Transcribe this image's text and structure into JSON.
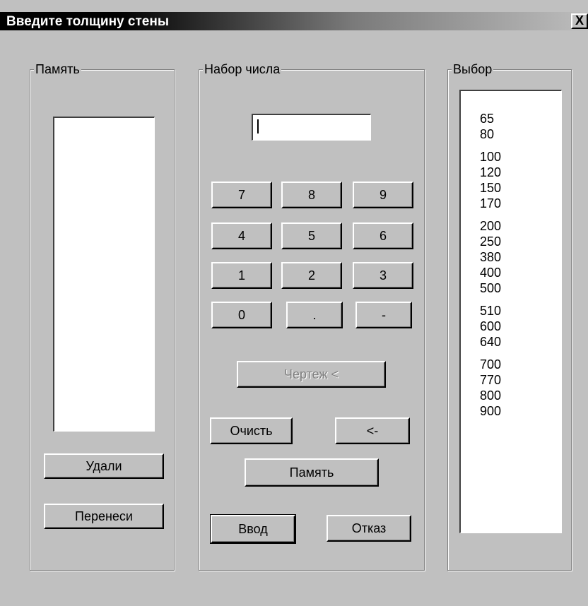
{
  "window": {
    "title": "Введите толщину стены",
    "close_label": "X"
  },
  "memory": {
    "legend": "Память",
    "delete_label": "Удали",
    "transfer_label": "Перенеси"
  },
  "entry": {
    "legend": "Набор числа",
    "input_value": "",
    "keys": [
      [
        "7",
        "8",
        "9"
      ],
      [
        "4",
        "5",
        "6"
      ],
      [
        "1",
        "2",
        "3"
      ],
      [
        "0",
        ".",
        "-"
      ]
    ],
    "drawing_label": "Чертеж <",
    "clear_label": "Очисть",
    "backspace_label": "<-",
    "memory_label": "Память",
    "enter_label": "Ввод",
    "cancel_label": "Отказ"
  },
  "choice": {
    "legend": "Выбор",
    "groups": [
      [
        "65",
        "80"
      ],
      [
        "100",
        "120",
        "150",
        "170"
      ],
      [
        "200",
        "250",
        "380",
        "400",
        "500"
      ],
      [
        "510",
        "600",
        "640"
      ],
      [
        "700",
        "770",
        "800",
        "900"
      ]
    ]
  }
}
